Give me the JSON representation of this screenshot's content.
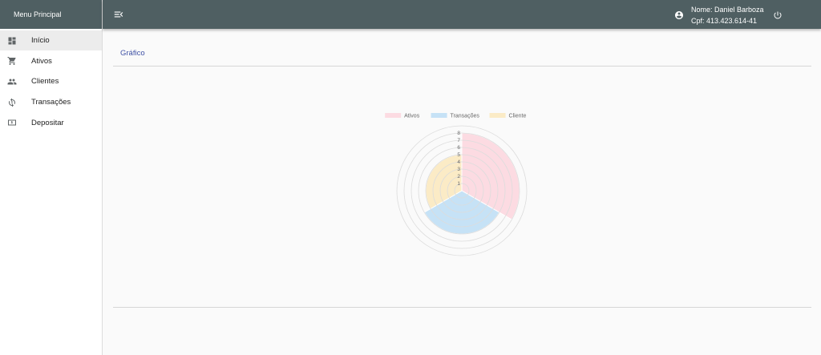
{
  "sidebar": {
    "title": "Menu Principal",
    "items": [
      {
        "label": "Início",
        "icon": "dashboard-icon",
        "active": true
      },
      {
        "label": "Ativos",
        "icon": "cart-icon",
        "active": false
      },
      {
        "label": "Clientes",
        "icon": "people-icon",
        "active": false
      },
      {
        "label": "Transações",
        "icon": "sync-dollar-icon",
        "active": false
      },
      {
        "label": "Depositar",
        "icon": "money-icon",
        "active": false
      }
    ]
  },
  "topbar": {
    "menu_icon": "menu-open-icon",
    "account_icon": "account-circle-icon",
    "user_name": "Nome: Daniel Barboza",
    "user_cpf": "Cpf: 413.423.614-41",
    "power_icon": "power-icon"
  },
  "main": {
    "section_title": "Gráfico"
  },
  "chart_data": {
    "type": "polarArea",
    "categories": [
      "Ativos",
      "Transações",
      "Cliente"
    ],
    "values": [
      8,
      6,
      5
    ],
    "colors": [
      "#fcdbe2",
      "#c6e2f6",
      "#fbebc6"
    ],
    "legend_position": "top",
    "r_ticks": [
      "1",
      "2",
      "3",
      "4",
      "5",
      "6",
      "7",
      "8"
    ],
    "r_max": 9
  }
}
